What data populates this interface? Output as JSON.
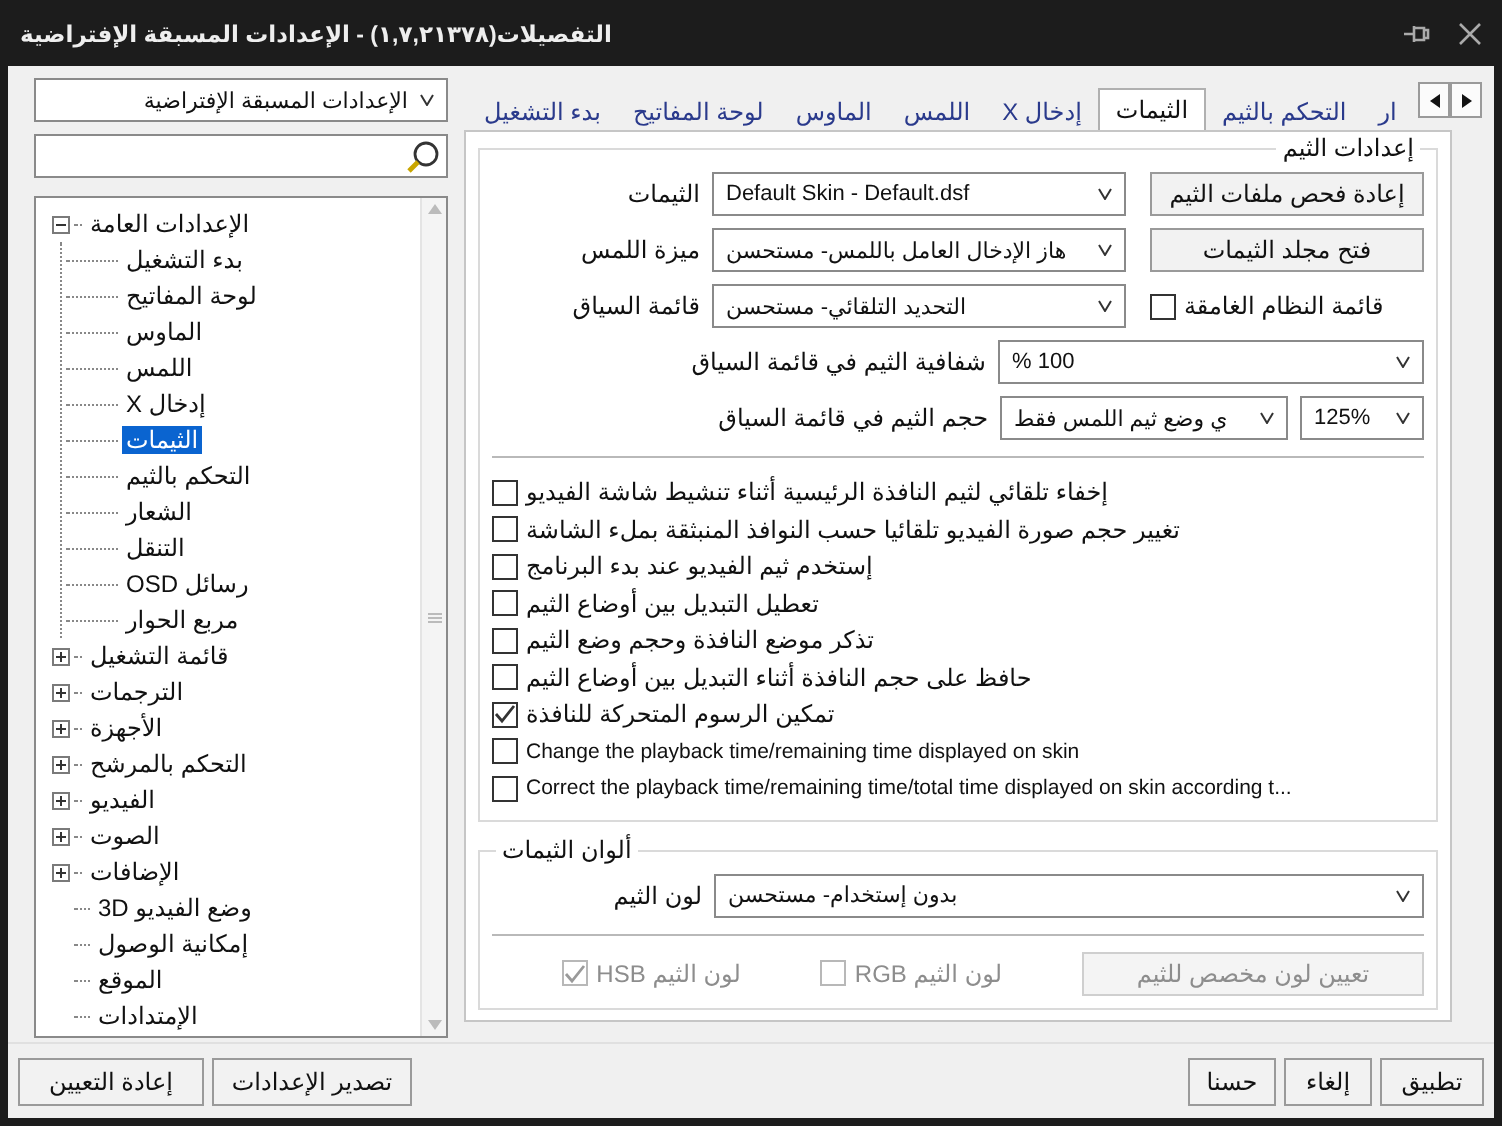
{
  "window": {
    "title": "التفصيلات(١,٧,٢١٣٧٨) - الإعدادات المسبقة الإفتراضية"
  },
  "preset": {
    "value": "الإعدادات المسبقة الإفتراضية"
  },
  "tree": [
    {
      "label": "الإعدادات العامة",
      "expanded": true,
      "selected": false,
      "children": [
        {
          "label": "بدء التشغيل",
          "selected": false
        },
        {
          "label": "لوحة المفاتيح",
          "selected": false
        },
        {
          "label": "الماوس",
          "selected": false
        },
        {
          "label": "اللمس",
          "selected": false
        },
        {
          "label": "إدخال X",
          "selected": false
        },
        {
          "label": "الثيمات",
          "selected": true
        },
        {
          "label": "التحكم بالثيم",
          "selected": false
        },
        {
          "label": "الشعار",
          "selected": false
        },
        {
          "label": "التنقل",
          "selected": false
        },
        {
          "label": "رسائل OSD",
          "selected": false
        },
        {
          "label": "مربع الحوار",
          "selected": false
        }
      ]
    },
    {
      "label": "قائمة التشغيل",
      "expanded": false,
      "selected": false
    },
    {
      "label": "الترجمات",
      "expanded": false,
      "selected": false
    },
    {
      "label": "الأجهزة",
      "expanded": false,
      "selected": false
    },
    {
      "label": "التحكم بالمرشح",
      "expanded": false,
      "selected": false
    },
    {
      "label": "الفيديو",
      "expanded": false,
      "selected": false
    },
    {
      "label": "الصوت",
      "expanded": false,
      "selected": false
    },
    {
      "label": "الإضافات",
      "expanded": false,
      "selected": false
    },
    {
      "label": "وضع الفيديو 3D",
      "selected": false
    },
    {
      "label": "إمكانية الوصول",
      "selected": false
    },
    {
      "label": "الموقع",
      "selected": false
    },
    {
      "label": "الإمتدادات",
      "selected": false
    }
  ],
  "tabs": [
    {
      "label": "ار",
      "selected": false
    },
    {
      "label": "التحكم بالثيم",
      "selected": false
    },
    {
      "label": "الثيمات",
      "selected": true
    },
    {
      "label": "إدخال X",
      "selected": false
    },
    {
      "label": "اللمس",
      "selected": false
    },
    {
      "label": "الماوس",
      "selected": false
    },
    {
      "label": "لوحة المفاتيح",
      "selected": false
    },
    {
      "label": "بدء التشغيل",
      "selected": false
    }
  ],
  "skin_settings": {
    "title": "إعدادات الثيم",
    "rows": [
      {
        "label": "الثيمات",
        "value": "Default Skin - Default.dsf",
        "side": {
          "kind": "button",
          "label": "إعادة فحص ملفات الثيم"
        }
      },
      {
        "label": "ميزة اللمس",
        "value": "هاز الإدخال العامل باللمس- مستحسن",
        "side": {
          "kind": "button",
          "label": "فتح مجلد الثيمات"
        }
      },
      {
        "label": "قائمة السياق",
        "value": "التحديد التلقائي- مستحسن",
        "side": {
          "kind": "checkbox",
          "label": "قائمة النظام الغامقة",
          "checked": false
        }
      }
    ],
    "transparency": {
      "label": "شفافية الثيم في قائمة السياق",
      "value": "100 %"
    },
    "size": {
      "label": "حجم الثيم في قائمة السياق",
      "mode": "ي وضع ثيم اللمس فقط",
      "value": "125%"
    },
    "options": [
      {
        "label": "إخفاء تلقائي لثيم النافذة الرئيسية أثناء تنشيط شاشة الفيديو",
        "checked": false
      },
      {
        "label": "تغيير حجم صورة الفيديو تلقائيا حسب النوافذ المنبثقة بملء الشاشة",
        "checked": false
      },
      {
        "label": "إستخدم ثيم الفيديو عند بدء البرنامج",
        "checked": false
      },
      {
        "label": "تعطيل التبديل بين أوضاع الثيم",
        "checked": false
      },
      {
        "label": "تذكر موضع النافذة وحجم وضع الثيم",
        "checked": false
      },
      {
        "label": "حافظ على حجم النافذة أثناء التبديل بين أوضاع الثيم",
        "checked": false
      },
      {
        "label": "تمكين الرسوم المتحركة للنافذة",
        "checked": true
      },
      {
        "label": "Change the playback time/remaining time displayed on skin",
        "checked": false
      },
      {
        "label": "Correct the playback time/remaining time/total time displayed on skin according t...",
        "checked": false
      }
    ]
  },
  "skin_colors": {
    "title": "ألوان الثيمات",
    "label": "لون الثيم",
    "value": "بدون إستخدام- مستحسن",
    "custom_button": {
      "label": "تعيين لون مخصص للثيم",
      "disabled": true
    },
    "modes": [
      {
        "label": "لون الثيم RGB",
        "checked": false,
        "disabled": true
      },
      {
        "label": "لون الثيم HSB",
        "checked": true,
        "disabled": true
      }
    ]
  },
  "footer": {
    "right": [
      "تطبيق",
      "إلغاء",
      "حسنا"
    ],
    "left": [
      "تصدير الإعدادات",
      "إعادة التعيين"
    ]
  }
}
